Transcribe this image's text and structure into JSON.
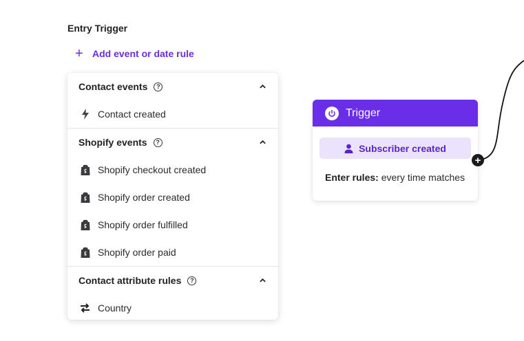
{
  "entry_trigger": {
    "title": "Entry Trigger",
    "add_rule_label": "Add event or date rule"
  },
  "dropdown": {
    "groups": [
      {
        "title": "Contact events",
        "items": [
          {
            "label": "Contact created",
            "icon": "lightning-icon"
          }
        ]
      },
      {
        "title": "Shopify events",
        "items": [
          {
            "label": "Shopify checkout created",
            "icon": "shopify-bag-icon"
          },
          {
            "label": "Shopify order created",
            "icon": "shopify-bag-icon"
          },
          {
            "label": "Shopify order fulfilled",
            "icon": "shopify-bag-icon"
          },
          {
            "label": "Shopify order paid",
            "icon": "shopify-bag-icon"
          }
        ]
      },
      {
        "title": "Contact attribute rules",
        "items": [
          {
            "label": "Country",
            "icon": "swap-arrows-icon"
          }
        ]
      }
    ]
  },
  "trigger_card": {
    "title": "Trigger",
    "subscriber_label": "Subscriber created",
    "rules_label": "Enter rules:",
    "rules_value": "every time matches"
  },
  "colors": {
    "accent": "#6a2de8",
    "accent_light": "#ebe3fb",
    "text": "#1f1f24"
  }
}
